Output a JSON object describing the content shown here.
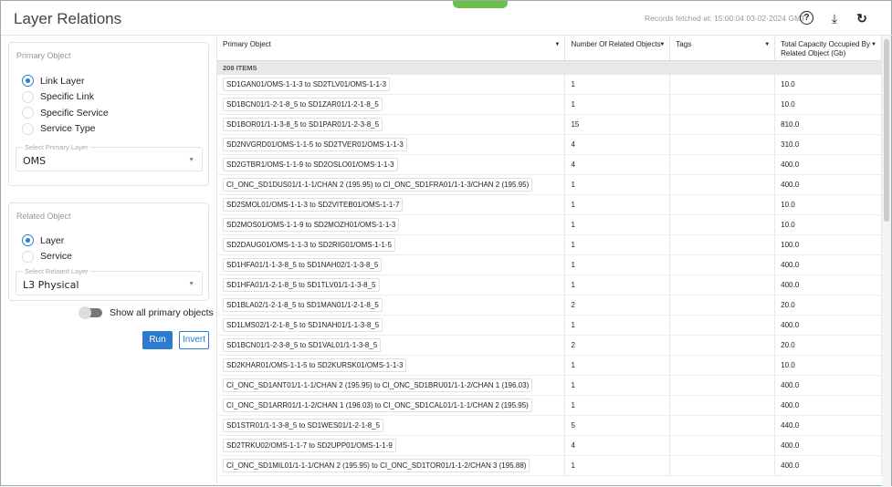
{
  "header": {
    "title": "Layer Relations",
    "fetched": "Records fetched at: 15:00:04 03-02-2024 GMT",
    "icons": [
      "help-icon",
      "download-icon",
      "refresh-icon"
    ]
  },
  "primary": {
    "title": "Primary Object",
    "options": [
      "Link Layer",
      "Specific Link",
      "Specific Service",
      "Service Type"
    ],
    "selected": 0,
    "select_label": "Select Primary Layer",
    "select_value": "OMS"
  },
  "related": {
    "title": "Related Object",
    "options": [
      "Layer",
      "Service"
    ],
    "selected": 0,
    "select_label": "Select Related Layer",
    "select_value": "L3 Physical"
  },
  "toggle_label": "Show all primary objects",
  "run_label": "Run",
  "invert_label": "Invert",
  "table": {
    "columns": [
      "Primary Object",
      "Number Of Related Objects",
      "Tags",
      "Total Capacity Occupied By Related Object (Gb)"
    ],
    "count": "208 ITEMS",
    "rows": [
      [
        "SD1GAN01/OMS-1-1-3 to SD2TLV01/OMS-1-1-3",
        "1",
        "",
        "10.0"
      ],
      [
        "SD1BCN01/1-2-1-8_5 to SD1ZAR01/1-2-1-8_5",
        "1",
        "",
        "10.0"
      ],
      [
        "SD1BOR01/1-1-3-8_5 to SD1PAR01/1-2-3-8_5",
        "15",
        "",
        "810.0"
      ],
      [
        "SD2NVGRD01/OMS-1-1-5 to SD2TVER01/OMS-1-1-3",
        "4",
        "",
        "310.0"
      ],
      [
        "SD2GTBR1/OMS-1-1-9 to SD2OSLO01/OMS-1-1-3",
        "4",
        "",
        "400.0"
      ],
      [
        "CI_ONC_SD1DUS01/1-1-1/CHAN 2 (195.95) to CI_ONC_SD1FRA01/1-1-3/CHAN 2 (195.95)",
        "1",
        "",
        "400.0"
      ],
      [
        "SD2SMOL01/OMS-1-1-3 to SD2VITEB01/OMS-1-1-7",
        "1",
        "",
        "10.0"
      ],
      [
        "SD2MOS01/OMS-1-1-9 to SD2MOZH01/OMS-1-1-3",
        "1",
        "",
        "10.0"
      ],
      [
        "SD2DAUG01/OMS-1-1-3 to SD2RIG01/OMS-1-1-5",
        "1",
        "",
        "100.0"
      ],
      [
        "SD1HFA01/1-1-3-8_5 to SD1NAH02/1-1-3-8_5",
        "1",
        "",
        "400.0"
      ],
      [
        "SD1HFA01/1-2-1-8_5 to SD1TLV01/1-1-3-8_5",
        "1",
        "",
        "400.0"
      ],
      [
        "SD1BLA02/1-2-1-8_5 to SD1MAN01/1-2-1-8_5",
        "2",
        "",
        "20.0"
      ],
      [
        "SD1LMS02/1-2-1-8_5 to SD1NAH01/1-1-3-8_5",
        "1",
        "",
        "400.0"
      ],
      [
        "SD1BCN01/1-2-3-8_5 to SD1VAL01/1-1-3-8_5",
        "2",
        "",
        "20.0"
      ],
      [
        "SD2KHAR01/OMS-1-1-5 to SD2KURSK01/OMS-1-1-3",
        "1",
        "",
        "10.0"
      ],
      [
        "CI_ONC_SD1ANT01/1-1-1/CHAN 2 (195.95) to CI_ONC_SD1BRU01/1-1-2/CHAN 1 (196.03)",
        "1",
        "",
        "400.0"
      ],
      [
        "CI_ONC_SD1ARR01/1-1-2/CHAN 1 (196.03) to CI_ONC_SD1CAL01/1-1-1/CHAN 2 (195.95)",
        "1",
        "",
        "400.0"
      ],
      [
        "SD1STR01/1-1-3-8_5 to SD1WES01/1-2-1-8_5",
        "5",
        "",
        "440.0"
      ],
      [
        "SD2TRKU02/OMS-1-1-7 to SD2UPP01/OMS-1-1-9",
        "4",
        "",
        "400.0"
      ],
      [
        "CI_ONC_SD1MIL01/1-1-1/CHAN 2 (195.95) to CI_ONC_SD1TOR01/1-1-2/CHAN 3 (195.88)",
        "1",
        "",
        "400.0"
      ]
    ]
  }
}
